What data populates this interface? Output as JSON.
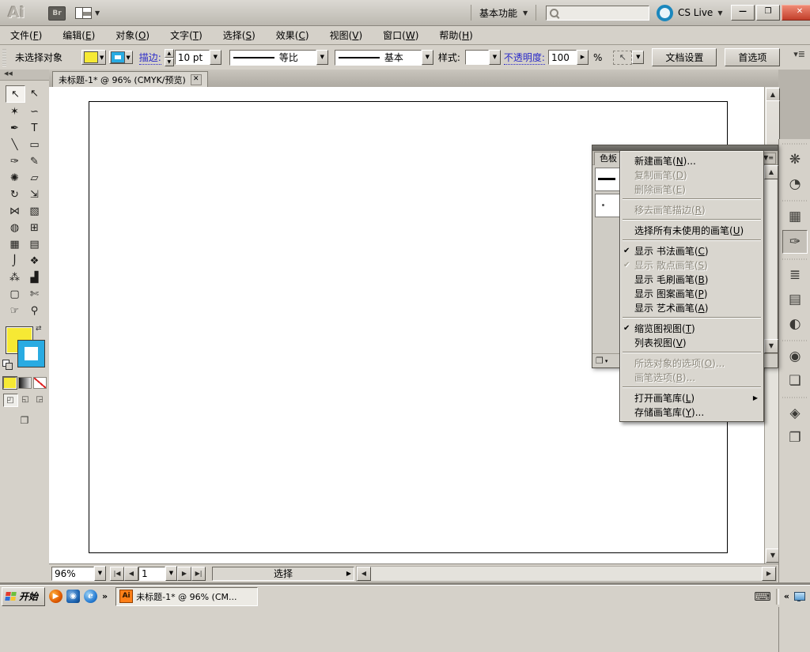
{
  "titlebar": {
    "logo": "Ai",
    "bridge_button": "Br",
    "workspace_switcher": "基本功能",
    "cs_live": "CS Live"
  },
  "icons": {
    "check": "✔",
    "submenu": "▶",
    "dropdown": "▼",
    "dropdown_small": "▾",
    "spinner_up": "▲",
    "spinner_down": "▼",
    "scroll_up": "▲",
    "scroll_down": "▼",
    "scroll_left": "◀",
    "scroll_right": "▶",
    "nav_first": "|◀",
    "nav_prev": "◀",
    "nav_next": "▶",
    "nav_last": "▶|",
    "status_arrow": "▶",
    "minimize": "—",
    "restore": "❐",
    "close": "✕",
    "tab_close": "✕",
    "collapse_double": "◀◀",
    "panel_menu": "▼≡",
    "isolate_cursor": "↖",
    "screen_mode": "❐",
    "library_menu": "❐",
    "swap_colors": "⇄",
    "hamburger": "▾≣",
    "keyboard": "⌨"
  },
  "menubar": {
    "items": [
      {
        "text": "文件",
        "key": "F"
      },
      {
        "text": "编辑",
        "key": "E"
      },
      {
        "text": "对象",
        "key": "O"
      },
      {
        "text": "文字",
        "key": "T"
      },
      {
        "text": "选择",
        "key": "S"
      },
      {
        "text": "效果",
        "key": "C"
      },
      {
        "text": "视图",
        "key": "V"
      },
      {
        "text": "窗口",
        "key": "W"
      },
      {
        "text": "帮助",
        "key": "H"
      }
    ]
  },
  "controlbar": {
    "no_selection": "未选择对象",
    "stroke_label": "描边:",
    "stroke_width": "10 pt",
    "width_profile": "等比",
    "brush_definition": "基本",
    "style_label": "样式:",
    "opacity_label": "不透明度:",
    "opacity_value": "100",
    "percent": "%",
    "document_setup": "文档设置",
    "preferences": "首选项",
    "fill_color": "#f6e934",
    "stroke_color": "#29abe2"
  },
  "tools": [
    {
      "name": "selection-tool",
      "glyph": "↖",
      "selected": true
    },
    {
      "name": "direct-selection-tool",
      "glyph": "↖"
    },
    {
      "name": "magic-wand-tool",
      "glyph": "✶"
    },
    {
      "name": "lasso-tool",
      "glyph": "∽"
    },
    {
      "name": "pen-tool",
      "glyph": "✒"
    },
    {
      "name": "type-tool",
      "glyph": "T"
    },
    {
      "name": "line-segment-tool",
      "glyph": "╲"
    },
    {
      "name": "rectangle-tool",
      "glyph": "▭"
    },
    {
      "name": "paintbrush-tool",
      "glyph": "✑"
    },
    {
      "name": "pencil-tool",
      "glyph": "✎"
    },
    {
      "name": "blob-brush-tool",
      "glyph": "✺"
    },
    {
      "name": "eraser-tool",
      "glyph": "▱"
    },
    {
      "name": "rotate-tool",
      "glyph": "↻"
    },
    {
      "name": "scale-tool",
      "glyph": "⇲"
    },
    {
      "name": "width-tool",
      "glyph": "⋈"
    },
    {
      "name": "free-transform-tool",
      "glyph": "▧"
    },
    {
      "name": "shape-builder-tool",
      "glyph": "◍"
    },
    {
      "name": "perspective-grid-tool",
      "glyph": "⊞"
    },
    {
      "name": "mesh-tool",
      "glyph": "▦"
    },
    {
      "name": "gradient-tool",
      "glyph": "▤"
    },
    {
      "name": "eyedropper-tool",
      "glyph": "⌡"
    },
    {
      "name": "blend-tool",
      "glyph": "❖"
    },
    {
      "name": "symbol-sprayer-tool",
      "glyph": "⁂"
    },
    {
      "name": "column-graph-tool",
      "glyph": "▟"
    },
    {
      "name": "artboard-tool",
      "glyph": "▢"
    },
    {
      "name": "slice-tool",
      "glyph": "✄"
    },
    {
      "name": "hand-tool",
      "glyph": "☞"
    },
    {
      "name": "zoom-tool",
      "glyph": "⚲"
    }
  ],
  "dock_icons": [
    {
      "name": "color-panel-icon",
      "glyph": "❋",
      "group_start": true
    },
    {
      "name": "color-guide-panel-icon",
      "glyph": "◔"
    },
    {
      "name": "swatches-panel-icon",
      "glyph": "▦",
      "group_start": true
    },
    {
      "name": "brushes-panel-icon",
      "glyph": "✑",
      "selected": true
    },
    {
      "name": "stroke-panel-icon",
      "glyph": "≣",
      "group_start": true
    },
    {
      "name": "gradient-panel-icon",
      "glyph": "▤"
    },
    {
      "name": "transparency-panel-icon",
      "glyph": "◐"
    },
    {
      "name": "appearance-panel-icon",
      "glyph": "◉",
      "group_start": true
    },
    {
      "name": "graphic-styles-panel-icon",
      "glyph": "❏"
    },
    {
      "name": "layers-panel-icon",
      "glyph": "◈",
      "group_start": true
    },
    {
      "name": "artboards-panel-icon",
      "glyph": "❐"
    }
  ],
  "document": {
    "tab_title": "未标题-1* @ 96% (CMYK/预览)",
    "zoom_level": "96%",
    "artboard_number": "1",
    "status": "选择"
  },
  "panel": {
    "visible_tab": "色板"
  },
  "context_menu": {
    "items": [
      {
        "id": "new-brush",
        "text": "新建画笔",
        "key": "N",
        "suffix": "..."
      },
      {
        "id": "duplicate-brush",
        "text": "复制画笔",
        "key": "D",
        "disabled": true
      },
      {
        "id": "delete-brush",
        "text": "删除画笔",
        "key": "E",
        "disabled": true
      },
      {
        "separator": true
      },
      {
        "id": "remove-brush-stroke",
        "text": "移去画笔描边",
        "key": "R",
        "disabled": true
      },
      {
        "separator": true
      },
      {
        "id": "select-all-unused-brushes",
        "text": "选择所有未使用的画笔",
        "key": "U"
      },
      {
        "separator": true
      },
      {
        "id": "show-calligraphic-brushes",
        "text": "显示 书法画笔",
        "key": "C",
        "checked": true
      },
      {
        "id": "show-scatter-brushes",
        "text": "显示 散点画笔",
        "key": "S",
        "checked": true,
        "disabled": true
      },
      {
        "id": "show-bristle-brushes",
        "text": "显示 毛刷画笔",
        "key": "B"
      },
      {
        "id": "show-pattern-brushes",
        "text": "显示 图案画笔",
        "key": "P"
      },
      {
        "id": "show-art-brushes",
        "text": "显示 艺术画笔",
        "key": "A"
      },
      {
        "separator": true
      },
      {
        "id": "thumbnail-view",
        "text": "缩览图视图",
        "key": "T",
        "checked": true
      },
      {
        "id": "list-view",
        "text": "列表视图",
        "key": "V"
      },
      {
        "separator": true
      },
      {
        "id": "options-of-selected-object",
        "text": "所选对象的选项",
        "key": "O",
        "suffix": "...",
        "disabled": true
      },
      {
        "id": "brush-options",
        "text": "画笔选项",
        "key": "B",
        "suffix": "...",
        "disabled": true
      },
      {
        "separator": true
      },
      {
        "id": "open-brush-library",
        "text": "打开画笔库",
        "key": "L",
        "submenu": true
      },
      {
        "id": "save-brush-library",
        "text": "存储画笔库",
        "key": "Y",
        "suffix": "..."
      }
    ]
  },
  "taskbar": {
    "start_label": "开始",
    "overflow": "»",
    "task_label": "未标题-1* @ 96% (CM...",
    "tray_collapse": "«"
  }
}
